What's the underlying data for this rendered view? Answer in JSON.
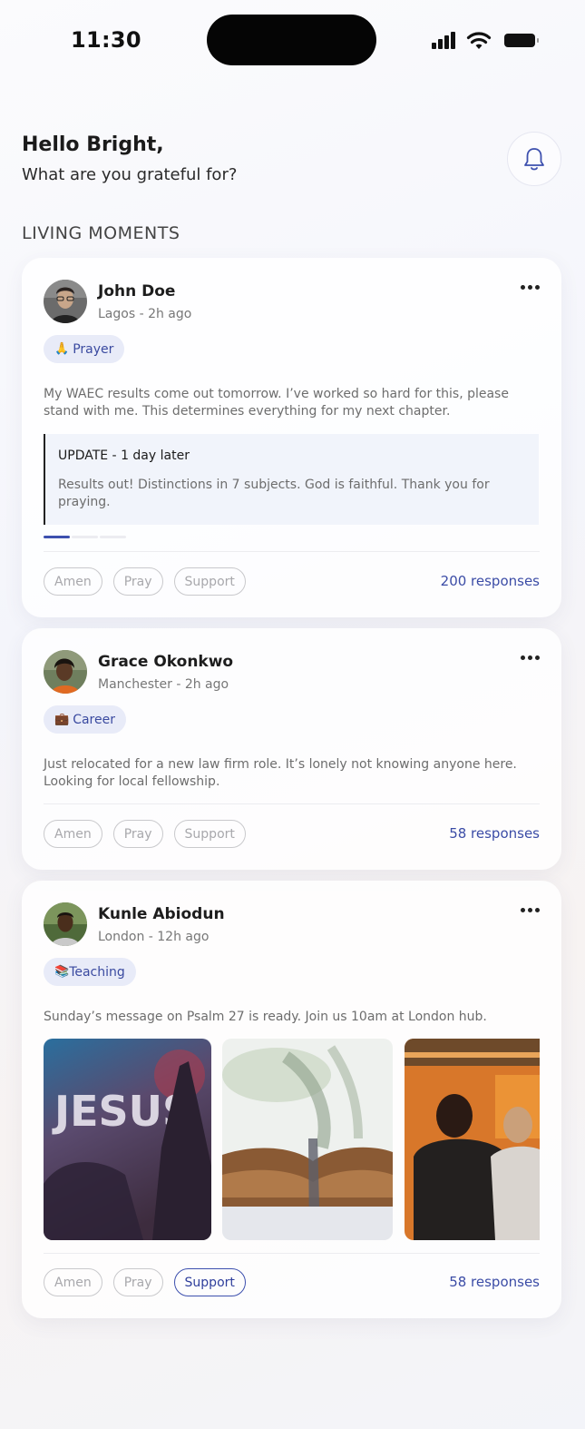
{
  "status_bar": {
    "time": "11:30"
  },
  "header": {
    "greeting": "Hello Bright,",
    "subtitle": "What are you grateful for?"
  },
  "section_title": "LIVING MOMENTS",
  "posts": [
    {
      "name": "John Doe",
      "meta": "Lagos - 2h ago",
      "tag_emoji": "🙏",
      "tag": "Prayer",
      "text": "My WAEC results come out tomorrow. I’ve worked so hard for this, please stand with me. This determines everything for my next chapter.",
      "update_title": "UPDATE - 1 day later",
      "update_text": "Results out! Distinctions in 7 subjects. God is faithful. Thank you for praying.",
      "update_progress": {
        "current": 1,
        "total": 3
      },
      "reactions": [
        "Amen",
        "Pray",
        "Support"
      ],
      "responses": "200 responses"
    },
    {
      "name": "Grace Okonkwo",
      "meta": "Manchester - 2h ago",
      "tag_emoji": "💼",
      "tag": "Career",
      "text": "Just relocated for a new law firm role. It’s lonely not knowing anyone here. Looking for local fellowship.",
      "reactions": [
        "Amen",
        "Pray",
        "Support"
      ],
      "responses": "58 responses"
    },
    {
      "name": "Kunle Abiodun",
      "meta": "London - 12h ago",
      "tag_emoji": "📚",
      "tag": "Teaching",
      "text": "Sunday’s message on Psalm 27 is ready. Join us 10am at London hub.",
      "photo_text": "JESUS",
      "reactions": [
        "Amen",
        "Pray",
        "Support"
      ],
      "active_reaction": "Support",
      "responses": "58 responses"
    }
  ],
  "colors": {
    "accent": "#3d50ae",
    "tag_bg": "#e8ebf8",
    "text_muted": "#6d6d6d"
  },
  "icons": [
    "signal-icon",
    "wifi-icon",
    "battery-icon",
    "bell-icon",
    "more-icon"
  ]
}
